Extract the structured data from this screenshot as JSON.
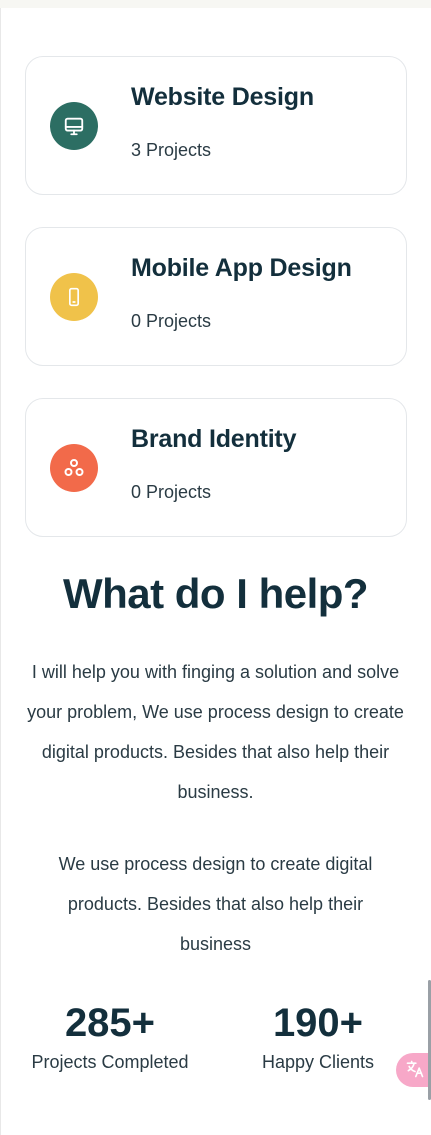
{
  "services": [
    {
      "title": "Website Design",
      "count": "3 Projects",
      "icon": "monitor-icon",
      "color": "#2c6e63"
    },
    {
      "title": "Mobile App Design",
      "count": "0 Projects",
      "icon": "phone-icon",
      "color": "#f0c24a"
    },
    {
      "title": "Brand Identity",
      "count": "0 Projects",
      "icon": "circles-icon",
      "color": "#f26a4a"
    }
  ],
  "help": {
    "title": "What do I help?",
    "paragraph1": "I will help you with finging a solution and solve your problem, We use process design to create digital products. Besides that also help their business.",
    "paragraph2": "We use process design to create digital products. Besides that also help their business"
  },
  "stats": [
    {
      "number": "285+",
      "label": "Projects Completed"
    },
    {
      "number": "190+",
      "label": "Happy Clients"
    }
  ],
  "translate": {
    "icon": "translate-icon"
  }
}
